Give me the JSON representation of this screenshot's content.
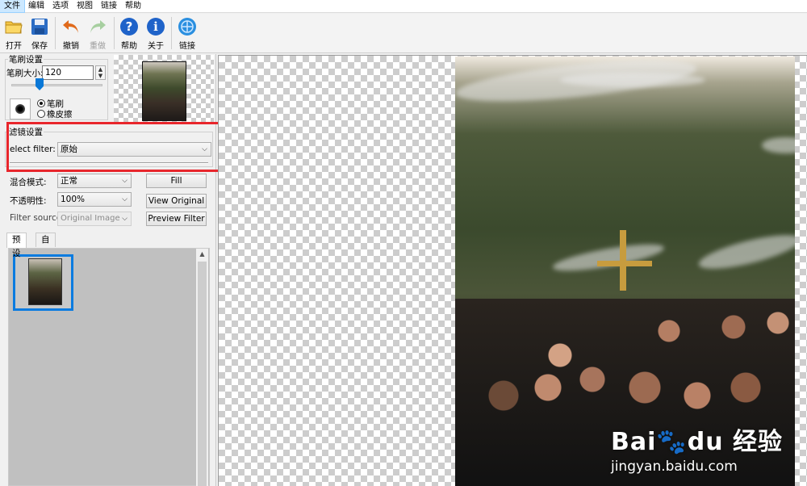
{
  "menubar": {
    "items": [
      "文件",
      "编辑",
      "选项",
      "视图",
      "链接",
      "帮助"
    ]
  },
  "toolbar": {
    "open": "打开",
    "save": "保存",
    "undo": "撤销",
    "redo": "重做",
    "help": "帮助",
    "about": "关于",
    "link": "链接"
  },
  "brush": {
    "group_title": "笔刷设置",
    "size_label": "笔刷大小:",
    "size_value": "120",
    "size_slider_level": 0.33,
    "mode_brush": "笔刷",
    "mode_eraser": "橡皮擦",
    "selected_mode": "笔刷"
  },
  "filter": {
    "group_title": "滤镜设置",
    "select_label": "elect filter:",
    "select_value": "原始"
  },
  "blend": {
    "mode_label": "混合模式:",
    "mode_value": "正常",
    "opacity_label": "不透明性:",
    "opacity_value": "100%",
    "source_label": "Filter source:",
    "source_value": "Original Image"
  },
  "buttons": {
    "fill": "Fill",
    "view_original": "View Original",
    "preview_filter": "Preview Filter"
  },
  "tabs": {
    "preset": "预设",
    "custom": "自定义",
    "selected": "预设"
  },
  "watermark": {
    "brand": "Bai🐾du 经验",
    "url": "jingyan.baidu.com"
  },
  "colors": {
    "highlight": "#e8262c",
    "accent": "#0a7be0",
    "cross": "#c79c3e"
  }
}
